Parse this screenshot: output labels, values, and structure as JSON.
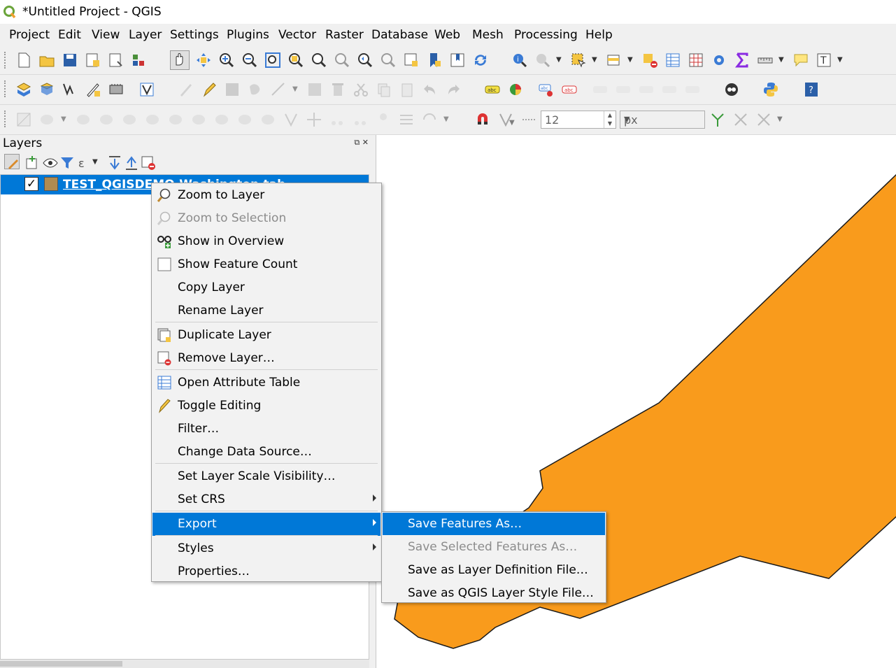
{
  "window": {
    "title": "*Untitled Project - QGIS"
  },
  "menubar": {
    "items": [
      "Project",
      "Edit",
      "View",
      "Layer",
      "Settings",
      "Plugins",
      "Vector",
      "Raster",
      "Database",
      "Web",
      "Mesh",
      "Processing",
      "Help"
    ]
  },
  "toolbar": {
    "snap_tolerance": "12",
    "snap_units": "px"
  },
  "layers_panel": {
    "title": "Layers",
    "layer": {
      "name": "TEST_QGISDEMO-Washington.tab",
      "checked": "✓"
    }
  },
  "context_menu": {
    "items": [
      {
        "label": "Zoom to Layer",
        "icon": "zoom-layer-icon",
        "enabled": true
      },
      {
        "label": "Zoom to Selection",
        "icon": "zoom-selection-icon",
        "enabled": false
      },
      {
        "label": "Show in Overview",
        "icon": "overview-icon",
        "enabled": true
      },
      {
        "label": "Show Feature Count",
        "icon": "checkbox-icon",
        "enabled": true
      },
      {
        "label": "Copy Layer",
        "enabled": true
      },
      {
        "label": "Rename Layer",
        "enabled": true
      },
      {
        "label": "Duplicate Layer",
        "icon": "duplicate-layer-icon",
        "enabled": true
      },
      {
        "label": "Remove Layer…",
        "icon": "remove-layer-icon",
        "enabled": true
      },
      {
        "label": "Open Attribute Table",
        "icon": "attribute-table-icon",
        "enabled": true
      },
      {
        "label": "Toggle Editing",
        "icon": "pencil-icon",
        "enabled": true
      },
      {
        "label": "Filter…",
        "enabled": true
      },
      {
        "label": "Change Data Source…",
        "enabled": true
      },
      {
        "label": "Set Layer Scale Visibility…",
        "enabled": true
      },
      {
        "label": "Set CRS",
        "submenu": true,
        "enabled": true
      },
      {
        "label": "Export",
        "submenu": true,
        "selected": true,
        "enabled": true
      },
      {
        "label": "Styles",
        "submenu": true,
        "enabled": true
      },
      {
        "label": "Properties…",
        "enabled": true
      }
    ]
  },
  "export_submenu": {
    "items": [
      {
        "label": "Save Features As…",
        "selected": true,
        "enabled": true
      },
      {
        "label": "Save Selected Features As…",
        "enabled": false
      },
      {
        "label": "Save as Layer Definition File…",
        "enabled": true
      },
      {
        "label": "Save as QGIS Layer Style File…",
        "enabled": true
      }
    ]
  },
  "map": {
    "polygon_fill": "#f99b1c",
    "polygon_stroke": "#1a1a1a"
  },
  "colors": {
    "accent": "#0078d7"
  }
}
